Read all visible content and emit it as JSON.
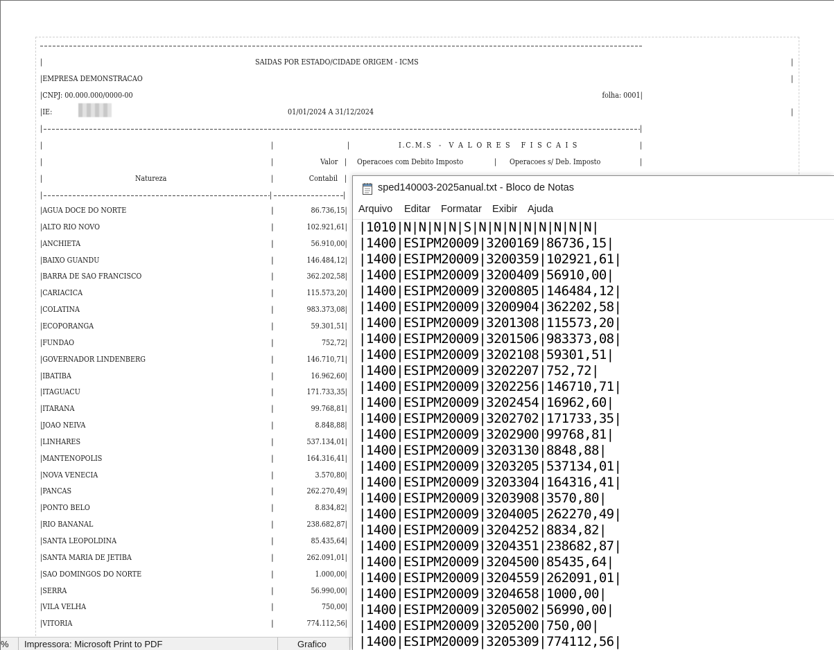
{
  "report": {
    "title": "SAIDAS POR ESTADO/CIDADE ORIGEM - ICMS",
    "company": "|EMPRESA DEMONSTRACAO",
    "cnpj": "|CNPJ: 00.000.000/0000-00",
    "sheet": "folha: 0001|",
    "ie_label": "|IE:",
    "period": "01/01/2024 A 31/12/2024",
    "icms_header": "I.C.M.S  -  V A L O R E S   F I S C A I S",
    "col_valor": "Valor",
    "col_contabil": "Contabil",
    "col_natureza": "Natureza",
    "col_op_debito": "Operacoes com Debito Imposto",
    "col_op_sem_debito": "Operacoes s/ Deb. Imposto",
    "rows": [
      {
        "name": "|AGUA DOCE DO NORTE",
        "value": "86.736,15|"
      },
      {
        "name": "|ALTO RIO NOVO",
        "value": "102.921,61|"
      },
      {
        "name": "|ANCHIETA",
        "value": "56.910,00|"
      },
      {
        "name": "|BAIXO GUANDU",
        "value": "146.484,12|"
      },
      {
        "name": "|BARRA DE SAO FRANCISCO",
        "value": "362.202,58|"
      },
      {
        "name": "|CARIACICA",
        "value": "115.573,20|"
      },
      {
        "name": "|COLATINA",
        "value": "983.373,08|"
      },
      {
        "name": "|ECOPORANGA",
        "value": "59.301,51|"
      },
      {
        "name": "|FUNDAO",
        "value": "752,72|"
      },
      {
        "name": "|GOVERNADOR LINDENBERG",
        "value": "146.710,71|"
      },
      {
        "name": "|IBATIBA",
        "value": "16.962,60|"
      },
      {
        "name": "|ITAGUACU",
        "value": "171.733,35|"
      },
      {
        "name": "|ITARANA",
        "value": "99.768,81|"
      },
      {
        "name": "|JOAO NEIVA",
        "value": "8.848,88|"
      },
      {
        "name": "|LINHARES",
        "value": "537.134,01|"
      },
      {
        "name": "|MANTENOPOLIS",
        "value": "164.316,41|"
      },
      {
        "name": "|NOVA VENECIA",
        "value": "3.570,80|"
      },
      {
        "name": "|PANCAS",
        "value": "262.270,49|"
      },
      {
        "name": "|PONTO BELO",
        "value": "8.834,82|"
      },
      {
        "name": "|RIO BANANAL",
        "value": "238.682,87|"
      },
      {
        "name": "|SANTA LEOPOLDINA",
        "value": "85.435,64|"
      },
      {
        "name": "|SANTA MARIA DE JETIBA",
        "value": "262.091,01|"
      },
      {
        "name": "|SAO DOMINGOS DO NORTE",
        "value": "1.000,00|"
      },
      {
        "name": "|SERRA",
        "value": "56.990,00|"
      },
      {
        "name": "|VILA VELHA",
        "value": "750,00|"
      },
      {
        "name": "|VITORIA",
        "value": "774.112,56|"
      }
    ]
  },
  "status_bar": {
    "zoom": "%",
    "printer": "Impressora: Microsoft Print to PDF",
    "mode": "Grafico"
  },
  "notepad": {
    "title": "sped140003-2025anual.txt - Bloco de Notas",
    "menu": [
      "Arquivo",
      "Editar",
      "Formatar",
      "Exibir",
      "Ajuda"
    ],
    "lines": [
      "|1010|N|N|N|N|S|N|N|N|N|N|N|N|N|",
      "|1400|ESIPM20009|3200169|86736,15|",
      "|1400|ESIPM20009|3200359|102921,61|",
      "|1400|ESIPM20009|3200409|56910,00|",
      "|1400|ESIPM20009|3200805|146484,12|",
      "|1400|ESIPM20009|3200904|362202,58|",
      "|1400|ESIPM20009|3201308|115573,20|",
      "|1400|ESIPM20009|3201506|983373,08|",
      "|1400|ESIPM20009|3202108|59301,51|",
      "|1400|ESIPM20009|3202207|752,72|",
      "|1400|ESIPM20009|3202256|146710,71|",
      "|1400|ESIPM20009|3202454|16962,60|",
      "|1400|ESIPM20009|3202702|171733,35|",
      "|1400|ESIPM20009|3202900|99768,81|",
      "|1400|ESIPM20009|3203130|8848,88|",
      "|1400|ESIPM20009|3203205|537134,01|",
      "|1400|ESIPM20009|3203304|164316,41|",
      "|1400|ESIPM20009|3203908|3570,80|",
      "|1400|ESIPM20009|3204005|262270,49|",
      "|1400|ESIPM20009|3204252|8834,82|",
      "|1400|ESIPM20009|3204351|238682,87|",
      "|1400|ESIPM20009|3204500|85435,64|",
      "|1400|ESIPM20009|3204559|262091,01|",
      "|1400|ESIPM20009|3204658|1000,00|",
      "|1400|ESIPM20009|3205002|56990,00|",
      "|1400|ESIPM20009|3205200|750,00|",
      "|1400|ESIPM20009|3205309|774112,56|"
    ]
  }
}
